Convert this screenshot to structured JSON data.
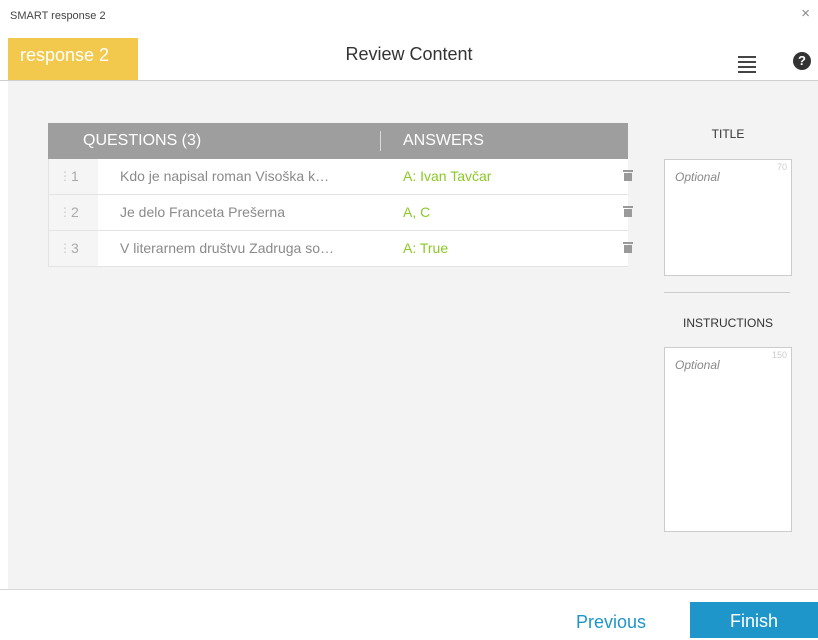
{
  "window": {
    "title": "SMART response 2",
    "close_glyph": "×"
  },
  "header": {
    "brand": "response 2",
    "title": "Review Content",
    "help_glyph": "?"
  },
  "table": {
    "questions_header": "QUESTIONS (3)",
    "answers_header": "ANSWERS",
    "rows": [
      {
        "num": "1",
        "question": "Kdo je napisal roman Visoška k…",
        "answer": "A: Ivan Tavčar"
      },
      {
        "num": "2",
        "question": "Je delo Franceta Prešerna",
        "answer": "A, C"
      },
      {
        "num": "3",
        "question": "V literarnem društvu Zadruga so…",
        "answer": "A: True"
      }
    ]
  },
  "side": {
    "title_label": "TITLE",
    "title_placeholder": "Optional",
    "title_max": "70",
    "instructions_label": "INSTRUCTIONS",
    "instructions_placeholder": "Optional",
    "instructions_max": "150"
  },
  "footer": {
    "previous": "Previous",
    "finish": "Finish"
  },
  "colors": {
    "brand": "#f2c94c",
    "accent": "#1e96c9",
    "answer": "#8ac926"
  },
  "icons": {
    "menu": "hamburger-menu-icon",
    "help": "help-circle-icon",
    "trash": "trash-icon",
    "grip": "drag-handle-icon"
  }
}
